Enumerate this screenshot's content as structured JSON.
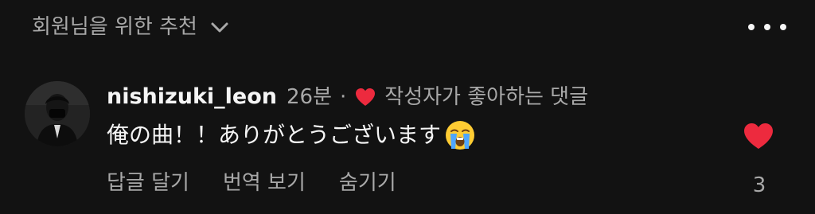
{
  "header": {
    "recommend_label": "회원님을 위한 추천"
  },
  "comment": {
    "username": "nishizuki_leon",
    "time": "26분",
    "separator": "·",
    "creator_liked_label": "작성자가 좋아하는 댓글",
    "text": "俺の曲！！ありがとうございます",
    "emoji": "loudly-crying-face",
    "actions": {
      "reply": "답글 달기",
      "translate": "번역 보기",
      "hide": "숨기기"
    },
    "like_count": "3",
    "liked": true
  },
  "colors": {
    "background": "#121212",
    "primary_text": "#f5f5f5",
    "secondary_text": "#a8a8a8",
    "heart": "#ed2a3e"
  }
}
